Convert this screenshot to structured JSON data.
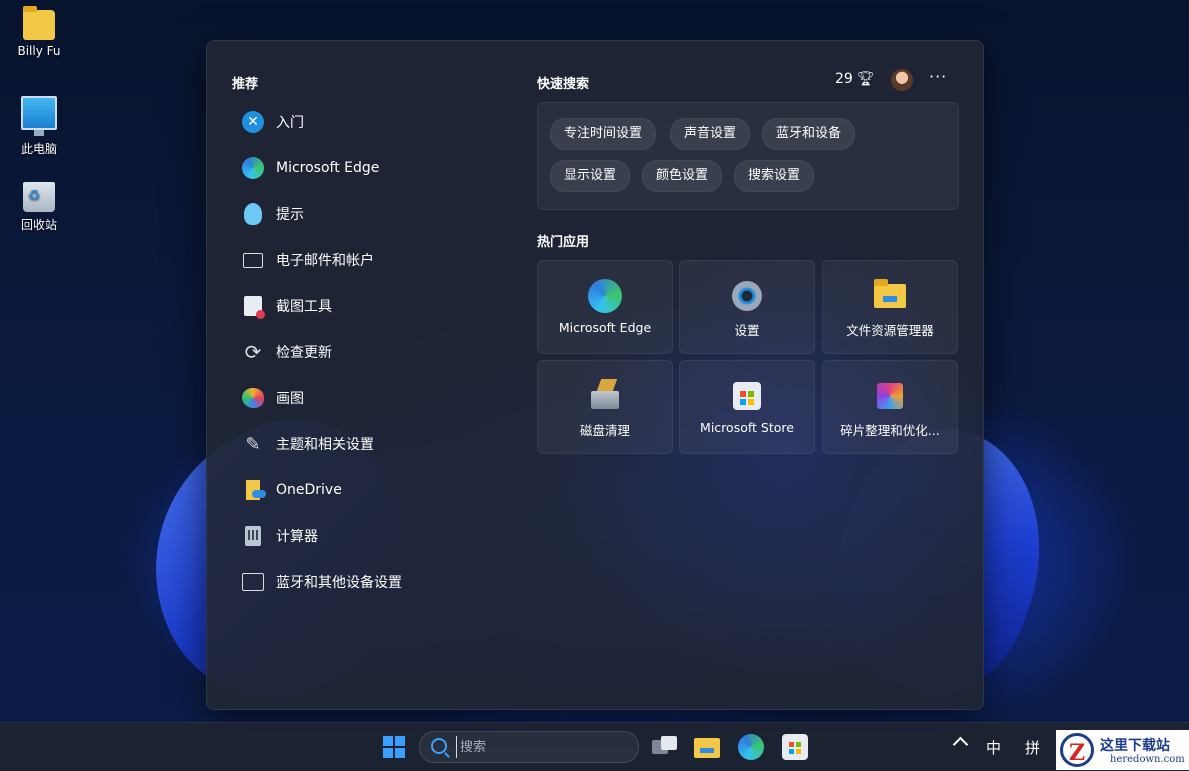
{
  "desktop": {
    "icons": [
      {
        "label": "Billy Fu"
      },
      {
        "label": "此电脑"
      },
      {
        "label": "回收站"
      }
    ]
  },
  "start_menu": {
    "recommended_title": "推荐",
    "recommended": [
      {
        "label": "入门",
        "icon": "get-started-icon"
      },
      {
        "label": "Microsoft Edge",
        "icon": "edge-icon"
      },
      {
        "label": "提示",
        "icon": "tips-bulb-icon"
      },
      {
        "label": "电子邮件和帐户",
        "icon": "mail-icon"
      },
      {
        "label": "截图工具",
        "icon": "snipping-tool-icon"
      },
      {
        "label": "检查更新",
        "icon": "sync-icon"
      },
      {
        "label": "画图",
        "icon": "paint-palette-icon"
      },
      {
        "label": "主题和相关设置",
        "icon": "brush-icon"
      },
      {
        "label": "OneDrive",
        "icon": "onedrive-folder-icon"
      },
      {
        "label": "计算器",
        "icon": "calculator-icon"
      },
      {
        "label": "蓝牙和其他设备设置",
        "icon": "devices-icon"
      }
    ],
    "quick_search_title": "快速搜索",
    "rewards_points": "29",
    "more_label": "···",
    "quick_search": [
      {
        "label": "专注时间设置"
      },
      {
        "label": "声音设置"
      },
      {
        "label": "蓝牙和设备"
      },
      {
        "label": "显示设置"
      },
      {
        "label": "颜色设置"
      },
      {
        "label": "搜索设置"
      }
    ],
    "top_apps_title": "热门应用",
    "top_apps": [
      {
        "label": "Microsoft Edge",
        "icon": "edge-icon"
      },
      {
        "label": "设置",
        "icon": "gear-icon"
      },
      {
        "label": "文件资源管理器",
        "icon": "file-explorer-icon"
      },
      {
        "label": "磁盘清理",
        "icon": "disk-cleanup-icon"
      },
      {
        "label": "Microsoft Store",
        "icon": "store-icon"
      },
      {
        "label": "碎片整理和优化...",
        "icon": "defrag-icon"
      }
    ]
  },
  "taskbar": {
    "search_placeholder": "搜索",
    "ime_mode": "中",
    "ime_layout": "拼"
  },
  "watermark": {
    "logo_letter": "Z",
    "name_cn": "这里下载站",
    "name_en": "heredown.com"
  }
}
